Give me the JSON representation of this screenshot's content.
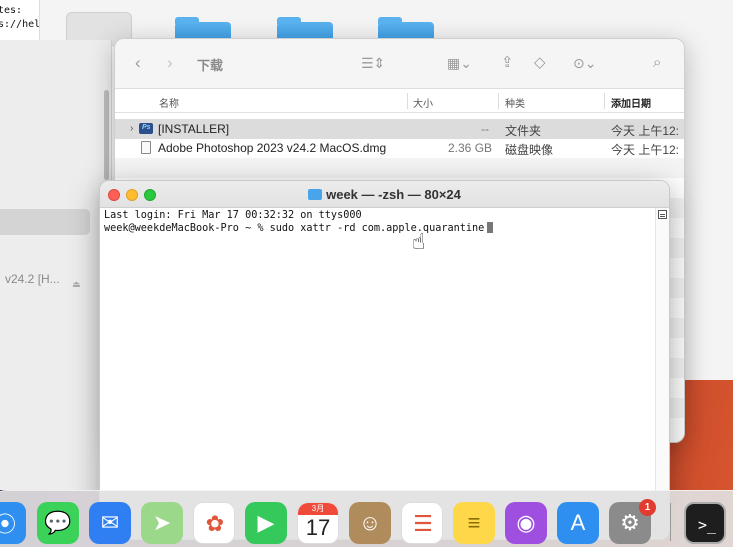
{
  "background_doc": {
    "lines": [
      "tes:",
      "s://hel"
    ]
  },
  "bg_window": {
    "truncated_label": "v24.2 [H...",
    "eject_icon": "eject-icon"
  },
  "finder": {
    "title": "下载",
    "toolbar_icons": [
      "back-icon",
      "forward-icon",
      "list-view-icon",
      "grid-view-icon",
      "share-icon",
      "tag-icon",
      "more-icon",
      "search-icon"
    ],
    "columns": {
      "name": "名称",
      "size": "大小",
      "kind": "种类",
      "date_added": "添加日期"
    },
    "rows": [
      {
        "name": "[INSTALLER]",
        "size": "--",
        "kind": "文件夹",
        "date": "今天 上午12:",
        "selected": true
      },
      {
        "name": "Adobe Photoshop 2023 v24.2 MacOS.dmg",
        "size": "2.36 GB",
        "kind": "磁盘映像",
        "date": "今天 上午12:",
        "selected": false
      }
    ]
  },
  "terminal": {
    "title": "week — -zsh — 80×24",
    "lines": [
      "Last login: Fri Mar 17 00:32:32 on ttys000",
      "week@weekdeMacBook-Pro ~ % sudo xattr -rd com.apple.quarantine"
    ]
  },
  "dock": {
    "apps": [
      {
        "name": "safari",
        "color": "#2f8ff0",
        "glyph": "⦿"
      },
      {
        "name": "messages",
        "color": "#3bd25a",
        "glyph": "💬"
      },
      {
        "name": "mail",
        "color": "#2f7ff2",
        "glyph": "✉"
      },
      {
        "name": "maps",
        "color": "#9bd88a",
        "glyph": "➤"
      },
      {
        "name": "photos",
        "color": "#ffffff",
        "glyph": "✿"
      },
      {
        "name": "facetime",
        "color": "#35c95b",
        "glyph": "▶"
      },
      {
        "name": "calendar",
        "color": "#ffffff",
        "glyph": ""
      },
      {
        "name": "contacts",
        "color": "#b08b5b",
        "glyph": "☺"
      },
      {
        "name": "reminders",
        "color": "#ffffff",
        "glyph": "☰"
      },
      {
        "name": "notes",
        "color": "#ffd84a",
        "glyph": "≡"
      },
      {
        "name": "podcasts",
        "color": "#9f4fe0",
        "glyph": "◉"
      },
      {
        "name": "app-store",
        "color": "#2f8ff0",
        "glyph": "A"
      },
      {
        "name": "system-preferences",
        "color": "#8b8b8b",
        "glyph": "⚙"
      },
      {
        "name": "terminal",
        "color": "#1e1e1e",
        "glyph": ">_"
      }
    ],
    "calendar": {
      "month": "3月",
      "day": "17"
    },
    "badge": "1"
  }
}
